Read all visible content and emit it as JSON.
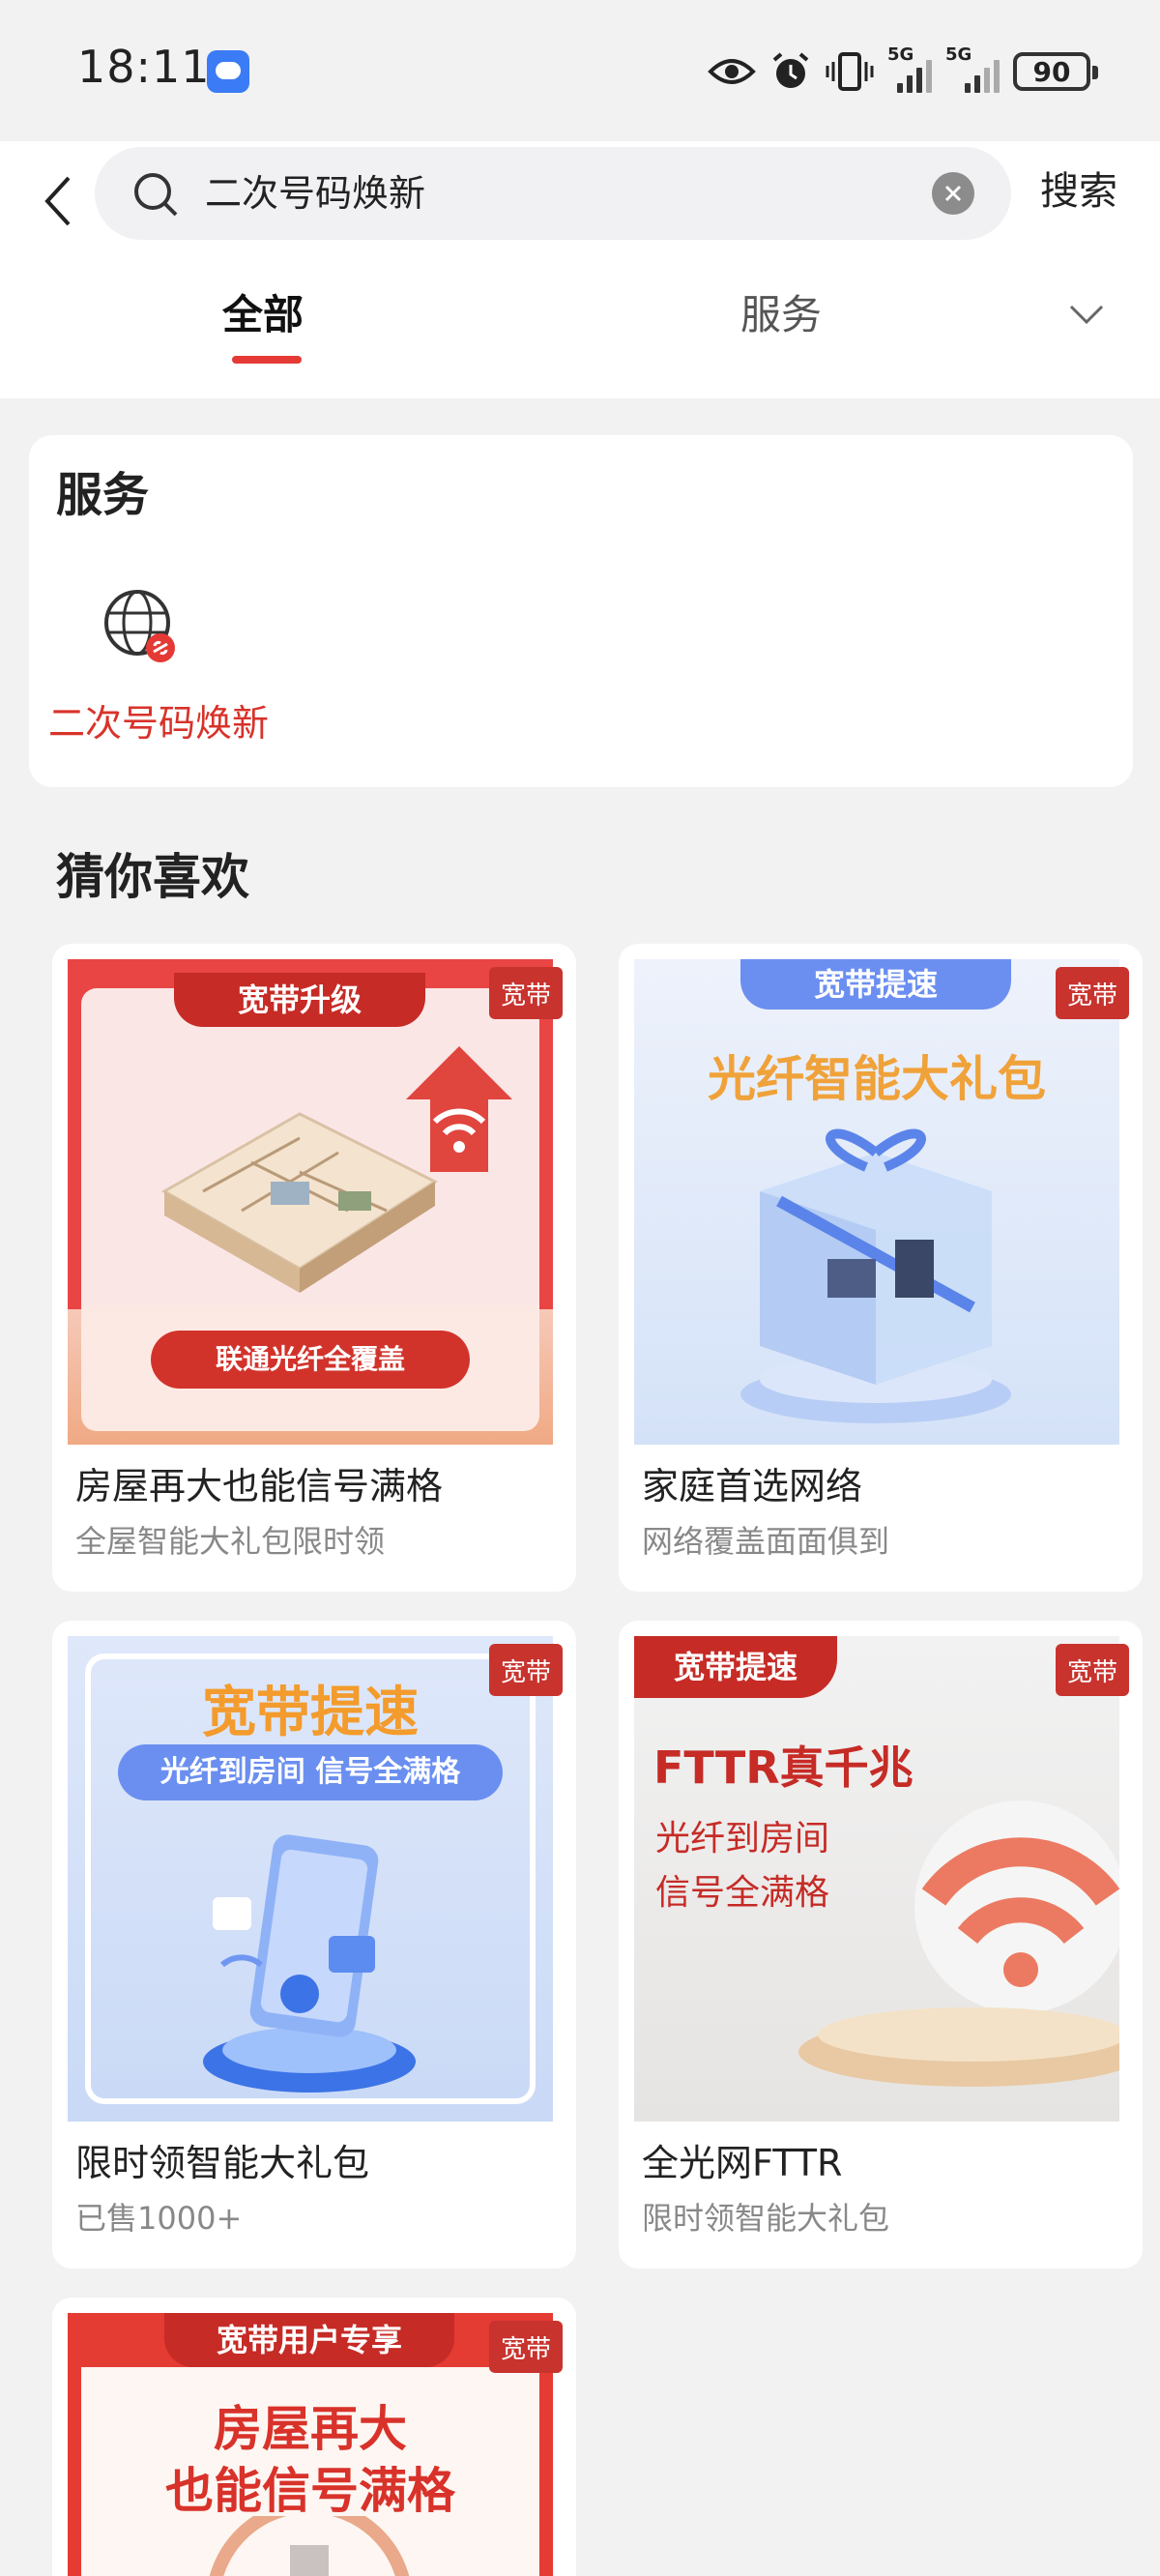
{
  "status": {
    "time": "18:11",
    "net1": "5G",
    "net2": "5G",
    "battery": "90"
  },
  "search": {
    "query": "二次号码焕新",
    "submit_label": "搜索"
  },
  "tabs": [
    {
      "label": "全部",
      "active": true
    },
    {
      "label": "服务",
      "active": false
    }
  ],
  "service_section": {
    "title": "服务",
    "items": [
      {
        "label": "二次号码焕新",
        "icon": "globe-link-icon"
      }
    ]
  },
  "guess": {
    "title": "猜你喜欢",
    "cards": [
      {
        "tag": "宽带",
        "title": "房屋再大也能信号满格",
        "subtitle": "全屋智能大礼包限时领",
        "image_banner": "宽带升级",
        "image_button": "联通光纤全覆盖"
      },
      {
        "tag": "宽带",
        "title": "家庭首选网络",
        "subtitle": "网络覆盖面面俱到",
        "image_banner": "宽带提速",
        "image_headline": "光纤智能大礼包"
      },
      {
        "tag": "宽带",
        "title": "限时领智能大礼包",
        "subtitle": "已售1000+",
        "image_headline": "宽带提速",
        "image_pill": "光纤到房间 信号全满格"
      },
      {
        "tag": "宽带",
        "title": "全光网FTTR",
        "subtitle": "限时领智能大礼包",
        "image_banner": "宽带提速",
        "image_headline": "FTTR真千兆",
        "image_line1": "光纤到房间",
        "image_line2": "信号全满格"
      },
      {
        "tag": "宽带",
        "image_banner": "宽带用户专享",
        "image_line1": "房屋再大",
        "image_line2": "也能信号满格"
      }
    ]
  },
  "colors": {
    "accent": "#e53935",
    "tag_bg": "#c8332e",
    "service_label": "#d8322a"
  }
}
